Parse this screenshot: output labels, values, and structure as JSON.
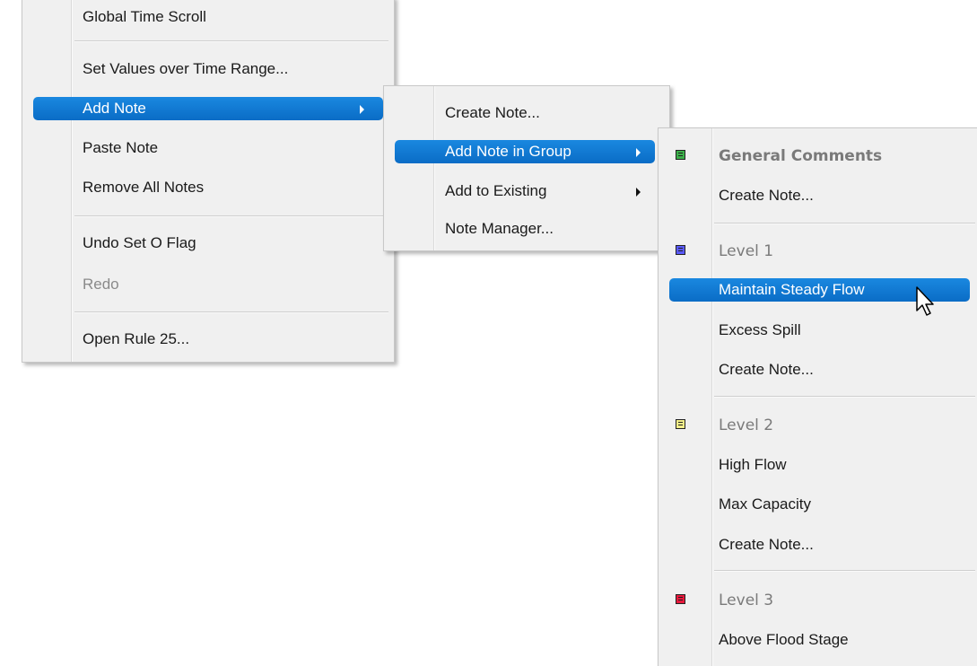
{
  "menu1": {
    "items": [
      {
        "label": "Global Time Scroll"
      },
      {
        "label": "Set Values over Time Range..."
      },
      {
        "label": "Add Note"
      },
      {
        "label": "Paste Note"
      },
      {
        "label": "Remove All Notes"
      },
      {
        "label": "Undo Set O Flag"
      },
      {
        "label": "Redo"
      },
      {
        "label": "Open Rule 25..."
      }
    ]
  },
  "menu2": {
    "items": [
      {
        "label": "Create Note..."
      },
      {
        "label": "Add Note in Group"
      },
      {
        "label": "Add to Existing"
      },
      {
        "label": "Note Manager..."
      }
    ]
  },
  "menu3": {
    "groups": [
      {
        "label": "General Comments",
        "color": "#3cb04a"
      },
      {
        "label": "Level 1",
        "color": "#5a5aff"
      },
      {
        "label": "Level 2",
        "color": "#f3ee8a"
      },
      {
        "label": "Level 3",
        "color": "#e8193c"
      }
    ],
    "items": [
      {
        "label": "Create Note..."
      },
      {
        "label": "Maintain Steady Flow"
      },
      {
        "label": "Excess Spill"
      },
      {
        "label": "Create Note..."
      },
      {
        "label": "High Flow"
      },
      {
        "label": "Max Capacity"
      },
      {
        "label": "Create Note..."
      },
      {
        "label": "Above Flood Stage"
      }
    ]
  },
  "icons": {
    "submenu_arrow": "submenu-arrow-icon",
    "group_icon": "note-group-icon",
    "cursor": "mouse-pointer-icon"
  },
  "colors": {
    "highlight": "#0a6cc6",
    "menu_bg": "#f0f0f0"
  }
}
